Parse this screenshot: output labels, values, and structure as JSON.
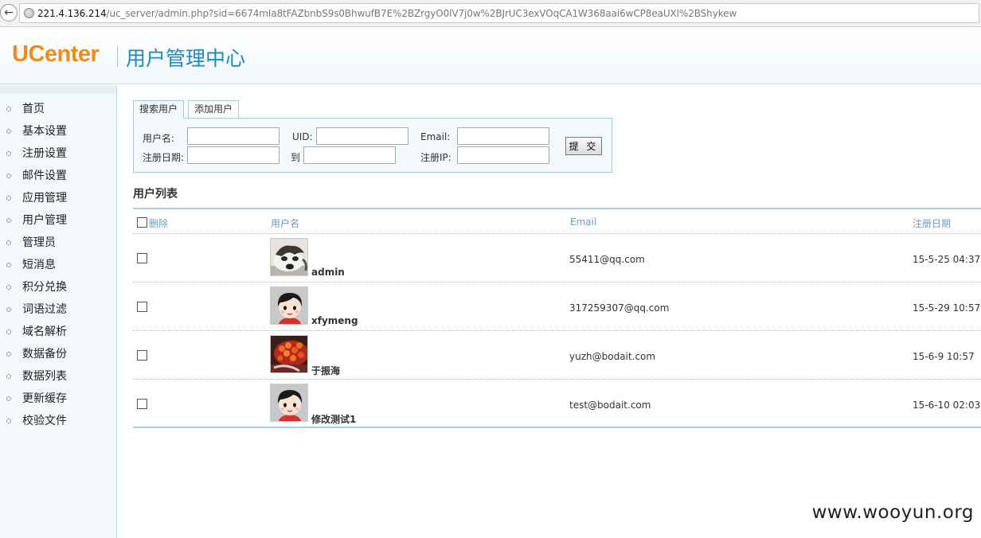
{
  "browser": {
    "url_host": "221.4.136.214",
    "url_path": "/uc_server/admin.php?sid=6674mIa8tFAZbnbS9s0BhwufB7E%2BZrgyO0lV7j0w%2BJrUC3exVOqCA1W368aai6wCP8eaUXl%2BShykew"
  },
  "header": {
    "logo": "UCenter",
    "title": "用户管理中心"
  },
  "sidebar": {
    "items": [
      {
        "label": "首页"
      },
      {
        "label": "基本设置"
      },
      {
        "label": "注册设置"
      },
      {
        "label": "邮件设置"
      },
      {
        "label": "应用管理"
      },
      {
        "label": "用户管理"
      },
      {
        "label": "管理员"
      },
      {
        "label": "短消息"
      },
      {
        "label": "积分兑换"
      },
      {
        "label": "词语过滤"
      },
      {
        "label": "域名解析"
      },
      {
        "label": "数据备份"
      },
      {
        "label": "数据列表"
      },
      {
        "label": "更新缓存"
      },
      {
        "label": "校验文件"
      }
    ]
  },
  "search": {
    "tab_search": "搜索用户",
    "tab_add": "添加用户",
    "username_label": "用户名:",
    "uid_label": "UID:",
    "email_label": "Email:",
    "regdate_label": "注册日期:",
    "to_label": "到",
    "regip_label": "注册IP:",
    "submit_label": "提 交",
    "username_value": "",
    "uid_value": "",
    "email_value": "",
    "regdate_from": "",
    "regdate_to": "",
    "regip_value": ""
  },
  "user_list": {
    "title": "用户列表",
    "columns": {
      "delete": "删除",
      "username": "用户名",
      "email": "Email",
      "regdate": "注册日期"
    },
    "rows": [
      {
        "username": "admin",
        "email": "55411@qq.com",
        "regdate": "15-5-25 04:37",
        "avatar": "husky-dog-photo"
      },
      {
        "username": "xfymeng",
        "email": "317259307@qq.com",
        "regdate": "15-5-29 10:57",
        "avatar": "default-cartoon-avatar"
      },
      {
        "username": "于振海",
        "email": "yuzh@bodait.com",
        "regdate": "15-6-9 10:57",
        "avatar": "food-photo"
      },
      {
        "username": "修改测试1",
        "email": "test@bodait.com",
        "regdate": "15-6-10 02:03",
        "avatar": "default-cartoon-avatar"
      }
    ]
  },
  "watermark": "www.wooyun.org",
  "colors": {
    "logo_orange": "#f18b1a",
    "title_blue": "#1a8ac0",
    "panel_bg": "#f2f8fc",
    "border_blue": "#a8c7da"
  }
}
